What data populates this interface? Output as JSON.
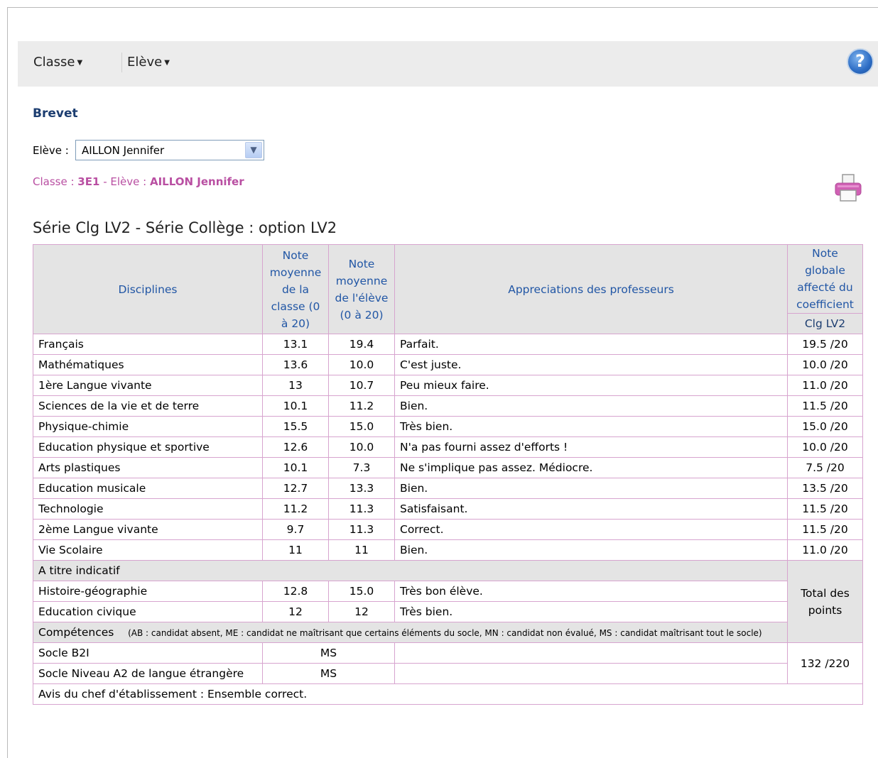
{
  "menu": {
    "classe_label": "Classe",
    "eleve_label": "Elève"
  },
  "page": {
    "title": "Brevet",
    "eleve_field_label": "Elève :",
    "eleve_selected": "AILLON Jennifer",
    "classe_prefix": "Classe :",
    "classe_value": "3E1",
    "eleve_prefix": "- Elève :",
    "eleve_value": "AILLON Jennifer",
    "serie_title": "Série Clg LV2 - Série Collège : option LV2"
  },
  "table": {
    "headers": {
      "disciplines": "Disciplines",
      "moyenne_classe": "Note moyenne de la classe (0 à 20)",
      "moyenne_eleve": "Note moyenne de l'élève (0 à 20)",
      "appreciations": "Appreciations des professeurs",
      "note_globale": "Note globale affecté du coefficient",
      "serie_code": "Clg LV2"
    },
    "rows": [
      {
        "discipline": "Français",
        "classe": "13.1",
        "eleve": "19.4",
        "appreciation": "Parfait.",
        "globale": "19.5 /20"
      },
      {
        "discipline": "Mathématiques",
        "classe": "13.6",
        "eleve": "10.0",
        "appreciation": "C'est juste.",
        "globale": "10.0 /20"
      },
      {
        "discipline": "1ère Langue vivante",
        "classe": "13",
        "eleve": "10.7",
        "appreciation": "Peu mieux faire.",
        "globale": "11.0 /20"
      },
      {
        "discipline": "Sciences de la vie et de terre",
        "classe": "10.1",
        "eleve": "11.2",
        "appreciation": "Bien.",
        "globale": "11.5 /20"
      },
      {
        "discipline": "Physique-chimie",
        "classe": "15.5",
        "eleve": "15.0",
        "appreciation": "Très bien.",
        "globale": "15.0 /20"
      },
      {
        "discipline": "Education physique et sportive",
        "classe": "12.6",
        "eleve": "10.0",
        "appreciation": "N'a pas fourni assez d'efforts !",
        "globale": "10.0 /20"
      },
      {
        "discipline": "Arts plastiques",
        "classe": "10.1",
        "eleve": "7.3",
        "appreciation": "Ne s'implique pas assez. Médiocre.",
        "globale": "7.5 /20"
      },
      {
        "discipline": "Education musicale",
        "classe": "12.7",
        "eleve": "13.3",
        "appreciation": "Bien.",
        "globale": "13.5 /20"
      },
      {
        "discipline": "Technologie",
        "classe": "11.2",
        "eleve": "11.3",
        "appreciation": "Satisfaisant.",
        "globale": "11.5 /20"
      },
      {
        "discipline": "2ème Langue vivante",
        "classe": "9.7",
        "eleve": "11.3",
        "appreciation": "Correct.",
        "globale": "11.5 /20"
      },
      {
        "discipline": "Vie Scolaire",
        "classe": "11",
        "eleve": "11",
        "appreciation": "Bien.",
        "globale": "11.0 /20"
      }
    ],
    "indicatif_label": "A titre indicatif",
    "indicatif_rows": [
      {
        "discipline": "Histoire-géographie",
        "classe": "12.8",
        "eleve": "15.0",
        "appreciation": "Très bon élève."
      },
      {
        "discipline": "Education civique",
        "classe": "12",
        "eleve": "12",
        "appreciation": "Très bien."
      }
    ],
    "total_label": "Total des points",
    "competences_label": "Compétences",
    "competences_note": "(AB : candidat absent, ME : candidat ne maîtrisant que certains éléments du socle, MN : candidat non évalué, MS : candidat maîtrisant tout le socle)",
    "socle_rows": [
      {
        "name": "Socle B2I",
        "value": "MS"
      },
      {
        "name": "Socle Niveau A2 de langue étrangère",
        "value": "MS"
      }
    ],
    "total_points": "132 /220",
    "avis": "Avis du chef d'établissement : Ensemble correct."
  }
}
